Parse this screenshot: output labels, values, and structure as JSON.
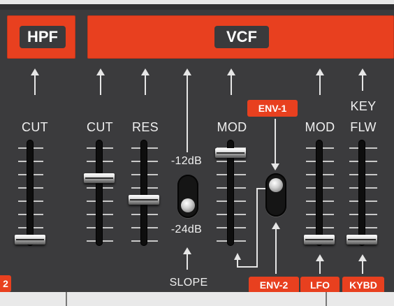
{
  "sections": {
    "hpf_label": "HPF",
    "vcf_label": "VCF"
  },
  "hpf": {
    "cut_label": "CUT",
    "cut_level": 0.03
  },
  "vcf": {
    "cut_label": "CUT",
    "cut_level": 0.68,
    "res_label": "RES",
    "res_level": 0.45,
    "slope_label": "SLOPE",
    "slope_high": "-12dB",
    "slope_low": "-24dB",
    "slope_selected": "-24dB",
    "mod_label": "MOD",
    "mod_level": 0.95,
    "env_source_top": "ENV-1",
    "env_source_bottom": "ENV-2",
    "env_switch_selected": "ENV-1",
    "lfo_mod_label": "MOD",
    "lfo_mod_level": 0.03,
    "lfo_tag": "LFO",
    "key_label_top": "KEY",
    "key_label_bottom": "FLW",
    "key_level": 0.03,
    "kybd_tag": "KYBD"
  },
  "left_edge_tag": "2",
  "colors": {
    "accent": "#e8401f",
    "panel": "#3b3b3d",
    "label_bg": "#3a3a3c",
    "text": "#f0f0f0"
  }
}
